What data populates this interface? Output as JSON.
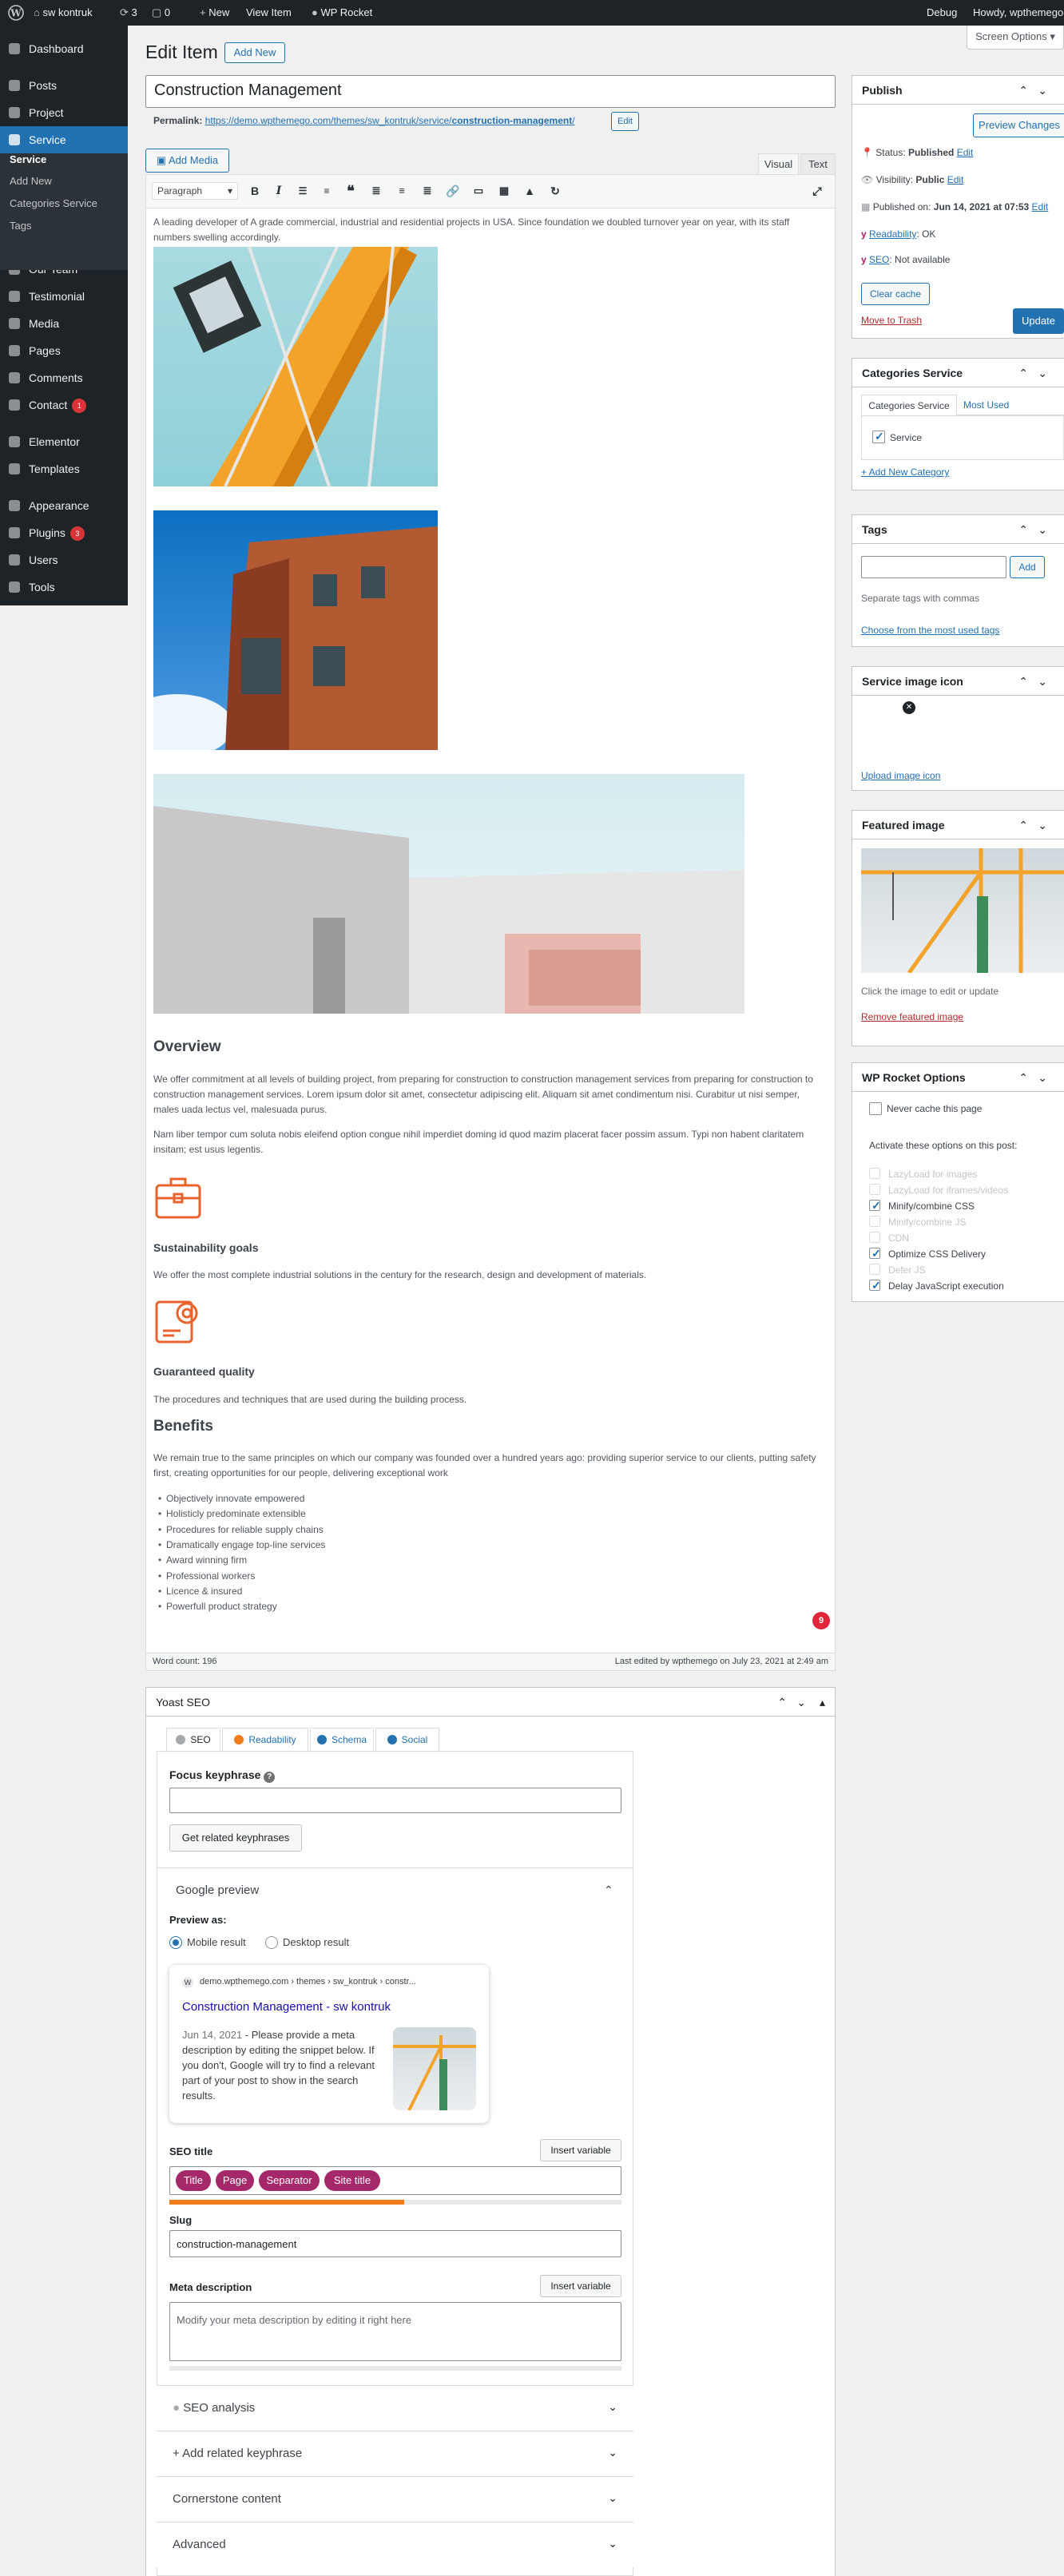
{
  "admin_bar": {
    "site_name": "sw kontruk",
    "updates_count": "3",
    "comments_count": "0",
    "new_label": "New",
    "view_item_label": "View Item",
    "wp_rocket_label": "WP Rocket",
    "debug_label": "Debug",
    "howdy": "Howdy, wpthemego"
  },
  "screen_options": "Screen Options",
  "sidebar": {
    "items": [
      {
        "label": "Dashboard",
        "icon": "dashboard-icon"
      },
      {
        "label": "Posts",
        "icon": "pin-icon"
      },
      {
        "label": "Project",
        "icon": "pin-icon"
      },
      {
        "label": "Service",
        "icon": "pin-icon"
      },
      {
        "label": "Our Team",
        "icon": "group-icon"
      },
      {
        "label": "Testimonial",
        "icon": "quote-icon"
      },
      {
        "label": "Media",
        "icon": "media-icon"
      },
      {
        "label": "Pages",
        "icon": "pages-icon"
      },
      {
        "label": "Comments",
        "icon": "comment-icon"
      },
      {
        "label": "Contact",
        "icon": "mail-icon",
        "badge": "1"
      },
      {
        "label": "Elementor",
        "icon": "elementor-icon"
      },
      {
        "label": "Templates",
        "icon": "folder-icon"
      },
      {
        "label": "Appearance",
        "icon": "brush-icon"
      },
      {
        "label": "Plugins",
        "icon": "plugin-icon",
        "badge": "3"
      },
      {
        "label": "Users",
        "icon": "user-icon"
      },
      {
        "label": "Tools",
        "icon": "wrench-icon"
      }
    ],
    "submenu": [
      "Service",
      "Add New",
      "Categories Service",
      "Tags"
    ]
  },
  "page": {
    "heading": "Edit Item",
    "add_new": "Add New",
    "title_value": "Construction Management",
    "permalink_label": "Permalink:",
    "permalink_base": "https://demo.wpthemego.com/themes/sw_kontruk/service/",
    "permalink_slug": "construction-management",
    "permalink_end": "/",
    "edit_label": "Edit",
    "add_media": "Add Media",
    "tab_visual": "Visual",
    "tab_text": "Text",
    "paragraph_select": "Paragraph"
  },
  "content": {
    "intro": "A leading developer of A grade commercial, industrial and residential projects in USA. Since foundation we doubled turnover year on year, with its staff numbers swelling accordingly.",
    "overview_heading": "Overview",
    "overview_p1": "We offer commitment at all levels of building project, from preparing for construction to construction management services from preparing for construction to construction management services. Lorem ipsum dolor sit amet, consectetur adipiscing elit. Aliquam sit amet condimentum nisi. Curabitur ut nisi semper, males uada lectus vel, malesuada purus.",
    "overview_p2": "Nam liber tempor cum soluta nobis eleifend option congue nihil imperdiet doming id quod mazim placerat facer possim assum. Typi non habent claritatem insitam; est usus legentis.",
    "sustain_heading": "Sustainability goals",
    "sustain_text": "We offer the most complete industrial solutions in the century for the research, design and development of materials.",
    "quality_heading": "Guaranteed quality",
    "quality_text": "The procedures and techniques that are used during the building process.",
    "benefits_heading": "Benefits",
    "benefits_text": "We remain true to the same principles on which our company was founded over a hundred years ago: providing superior service to our clients, putting safety first, creating opportunities for our people, delivering exceptional work",
    "benefits_list": [
      "Objectively innovate empowered",
      "Holisticly predominate extensible",
      "Procedures for reliable supply chains",
      "Dramatically engage top-line services",
      "Award winning firm",
      "Professional workers",
      "Licence & insured",
      "Powerfull product strategy"
    ],
    "grammarly_badge": "9",
    "word_count": "Word count: 196",
    "last_edited": "Last edited by wpthemego on July 23, 2021 at 2:49 am"
  },
  "publish": {
    "title": "Publish",
    "preview": "Preview Changes",
    "status_label": "Status:",
    "status_value": "Published",
    "visibility_label": "Visibility:",
    "visibility_value": "Public",
    "published_label": "Published on:",
    "published_value": "Jun 14, 2021 at 07:53",
    "readability_label": "Readability",
    "readability_value": ": OK",
    "seo_label": "SEO",
    "seo_value": ": Not available",
    "edit": "Edit",
    "clear_cache": "Clear cache",
    "trash": "Move to Trash",
    "update": "Update"
  },
  "categories": {
    "title": "Categories Service",
    "tab_all": "Categories Service",
    "tab_used": "Most Used",
    "item": "Service",
    "add_new": "+ Add New Category"
  },
  "tags": {
    "title": "Tags",
    "add": "Add",
    "hint": "Separate tags with commas",
    "choose": "Choose from the most used tags"
  },
  "service_icon": {
    "title": "Service image icon",
    "upload": "Upload image icon"
  },
  "featured": {
    "title": "Featured image",
    "hint": "Click the image to edit or update",
    "remove": "Remove featured image"
  },
  "rocket": {
    "title": "WP Rocket Options",
    "never_cache": "Never cache this page",
    "activate": "Activate these options on this post:",
    "options": [
      {
        "label": "LazyLoad for images",
        "checked": false,
        "disabled": true
      },
      {
        "label": "LazyLoad for iframes/videos",
        "checked": false,
        "disabled": true
      },
      {
        "label": "Minify/combine CSS",
        "checked": true,
        "disabled": false
      },
      {
        "label": "Minify/combine JS",
        "checked": false,
        "disabled": true
      },
      {
        "label": "CDN",
        "checked": false,
        "disabled": true
      },
      {
        "label": "Optimize CSS Delivery",
        "checked": true,
        "disabled": false
      },
      {
        "label": "Defer JS",
        "checked": false,
        "disabled": true
      },
      {
        "label": "Delay JavaScript execution",
        "checked": true,
        "disabled": false
      }
    ]
  },
  "yoast": {
    "title": "Yoast SEO",
    "tabs": [
      "SEO",
      "Readability",
      "Schema",
      "Social"
    ],
    "focus_label": "Focus keyphrase",
    "related_btn": "Get related keyphrases",
    "google_preview": "Google preview",
    "preview_as": "Preview as:",
    "mobile": "Mobile result",
    "desktop": "Desktop result",
    "snippet_url": "demo.wpthemego.com › themes › sw_kontruk › constr...",
    "snippet_title": "Construction Management - sw kontruk",
    "snippet_date": "Jun 14, 2021",
    "snippet_desc": "Please provide a meta description by editing the snippet below. If you don't, Google will try to find a relevant part of your post to show in the search results.",
    "seo_title_label": "SEO title",
    "insert_variable": "Insert variable",
    "pills": [
      "Title",
      "Page",
      "Separator",
      "Site title"
    ],
    "slug_label": "Slug",
    "slug_value": "construction-management",
    "meta_label": "Meta description",
    "meta_placeholder": "Modify your meta description by editing it right here",
    "sections": [
      "SEO analysis",
      "Add related keyphrase",
      "Cornerstone content",
      "Advanced"
    ]
  },
  "colors": {
    "accent": "#2271b1",
    "admin_dark": "#1d2327",
    "yoast_pill": "#a4286a",
    "icon_orange": "#e8642c"
  }
}
